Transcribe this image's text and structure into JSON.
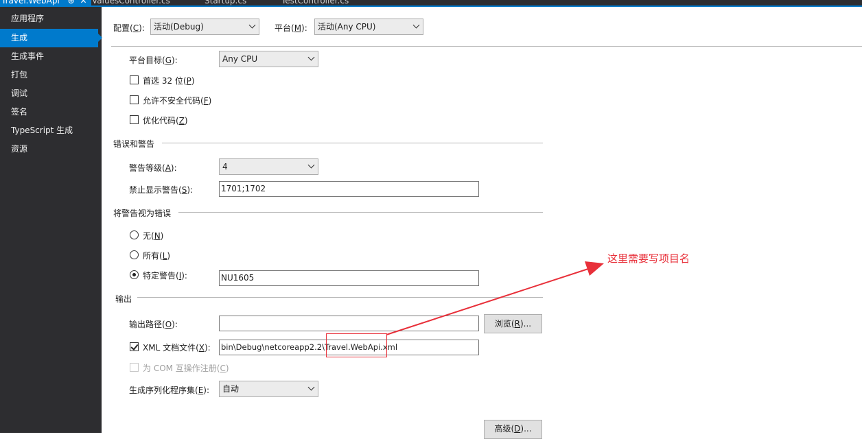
{
  "tabs": {
    "active": "Travel.WebApi",
    "pin_glyph": "⊕",
    "close_glyph": "✕",
    "others": [
      "ValuesController.cs",
      "Startup.cs",
      "TestController.cs"
    ]
  },
  "sidebar": {
    "items": [
      {
        "label": "应用程序"
      },
      {
        "label": "生成"
      },
      {
        "label": "生成事件"
      },
      {
        "label": "打包"
      },
      {
        "label": "调试"
      },
      {
        "label": "签名"
      },
      {
        "label": "TypeScript 生成"
      },
      {
        "label": "资源"
      }
    ],
    "active_index": 1
  },
  "config": {
    "config_label": "配置(",
    "config_key": "C",
    "config_tail": "):",
    "config_value": "活动(Debug)",
    "platform_label": "平台(",
    "platform_key": "M",
    "platform_tail": "):",
    "platform_value": "活动(Any CPU)"
  },
  "general": {
    "platform_target_label": "平台目标(",
    "platform_target_key": "G",
    "platform_target_tail": "):",
    "platform_target_value": "Any CPU",
    "prefer32_label": "首选 32 位(",
    "prefer32_key": "P",
    "prefer32_tail": ")",
    "unsafe_label": "允许不安全代码(",
    "unsafe_key": "F",
    "unsafe_tail": ")",
    "optimize_label": "优化代码(",
    "optimize_key": "Z",
    "optimize_tail": ")"
  },
  "errors": {
    "section_title": "错误和警告",
    "warning_level_label": "警告等级(",
    "warning_level_key": "A",
    "warning_level_tail": "):",
    "warning_level_value": "4",
    "suppress_label": "禁止显示警告(",
    "suppress_key": "S",
    "suppress_tail": "):",
    "suppress_value": "1701;1702"
  },
  "treat": {
    "section_title": "将警告视为错误",
    "none_label": "无(",
    "none_key": "N",
    "none_tail": ")",
    "all_label": "所有(",
    "all_key": "L",
    "all_tail": ")",
    "specific_label": "特定警告(",
    "specific_key": "I",
    "specific_tail": "):",
    "specific_value": "NU1605"
  },
  "output": {
    "section_title": "输出",
    "path_label": "输出路径(",
    "path_key": "O",
    "path_tail": "):",
    "path_value": "",
    "browse_label": "浏览(",
    "browse_key": "R",
    "browse_tail": ")...",
    "xml_label": "XML 文档文件(",
    "xml_key": "X",
    "xml_tail": "):",
    "xml_value": "bin\\Debug\\netcoreapp2.2\\Travel.WebApi.xml",
    "com_label": "为 COM 互操作注册(",
    "com_key": "C",
    "com_tail": ")",
    "serial_label": "生成序列化程序集(",
    "serial_key": "E",
    "serial_tail": "):",
    "serial_value": "自动"
  },
  "advanced": {
    "label": "高级(",
    "key": "D",
    "tail": ")..."
  },
  "annotation": {
    "text": "这里需要写项目名",
    "color": "#e8303a"
  },
  "colors": {
    "accent": "#007acc",
    "sidebar_bg": "#2d2d30"
  }
}
